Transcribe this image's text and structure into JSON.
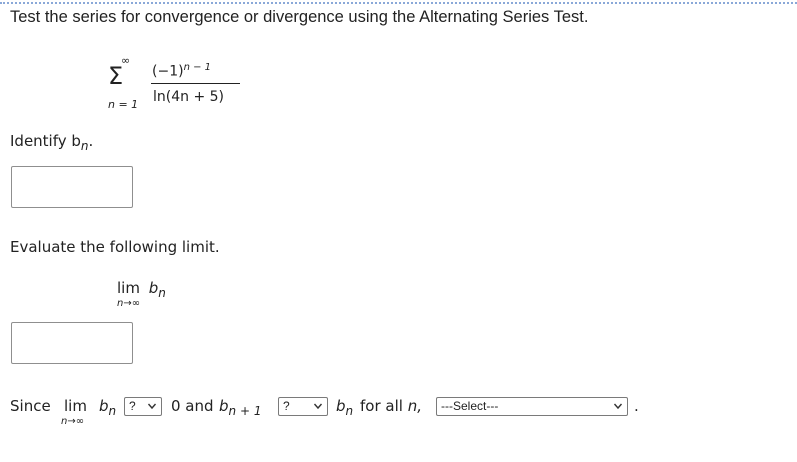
{
  "question": {
    "prompt": "Test the series for convergence or divergence using the Alternating Series Test."
  },
  "series": {
    "sigma": "Σ",
    "upper_limit": "∞",
    "lower_limit": "n = 1",
    "numerator_base": "(−1)",
    "numerator_exponent": "n − 1",
    "denominator": "ln(4n + 5)"
  },
  "step1": {
    "label": "Identify b",
    "label_sub": "n",
    "label_end": ".",
    "answer_value": ""
  },
  "step2": {
    "label": "Evaluate the following limit.",
    "lim": "lim",
    "lim_sub": "n→∞",
    "b": "b",
    "b_sub": "n",
    "answer_value": ""
  },
  "step3": {
    "since": "Since",
    "lim": "lim",
    "lim_sub": "n→∞",
    "b": "b",
    "b_sub": "n",
    "select1_value": "?",
    "zero_and": "0 and",
    "b2": "b",
    "b2_sub": "n + 1",
    "select2_value": "?",
    "b3": "b",
    "b3_sub": "n",
    "for_all": "for all",
    "n_var": "n,",
    "select3_value": "---Select---",
    "period": "."
  }
}
